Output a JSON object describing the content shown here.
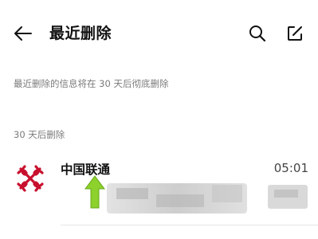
{
  "header": {
    "title": "最近删除",
    "back_icon": "back-arrow-icon",
    "search_icon": "search-icon",
    "edit_icon": "edit-icon"
  },
  "notice": "最近删除的信息将在 30 天后彻底删除",
  "section": {
    "label": "30 天后删除"
  },
  "messages": [
    {
      "sender": "中国联通",
      "time": "05:01",
      "avatar_icon": "china-unicom-logo",
      "brand_color": "#c8102e",
      "preview_state": "redacted"
    }
  ],
  "annotation": {
    "icon": "up-arrow-icon",
    "color": "#8cd12c"
  }
}
